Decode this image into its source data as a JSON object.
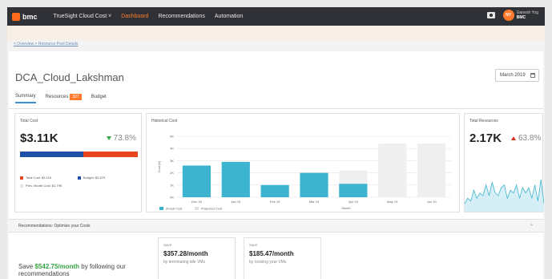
{
  "topbar": {
    "logo": "bmc",
    "product": "TrueSight Cloud Cost",
    "nav": [
      "Dashboard",
      "Recommendations",
      "Automation"
    ],
    "active_nav": "Dashboard",
    "avatar_initials": "NY",
    "user_name": "Ganesh Yog",
    "user_tenant": "BMC"
  },
  "breadcrumb": "< Overview > Resource Pool Details",
  "page": {
    "title": "DCA_Cloud_Lakshman",
    "date": "March 2019"
  },
  "tabs": {
    "summary": "Summary",
    "resources": "Resources",
    "resources_count": "327",
    "budget": "Budget"
  },
  "total_cost": {
    "title": "Total Cost",
    "value": "$3.11K",
    "delta": "73.8%",
    "budget_fraction": 0.54,
    "legend_total": "Total Cost: $3.11K",
    "legend_budget": "Budget: $3.67K",
    "legend_prev": "Prev. Month Cost: $1.79K",
    "colors": {
      "budget": "#1f4fa6",
      "cost": "#e8451f"
    }
  },
  "historical": {
    "title": "Historical Cost"
  },
  "chart_data": {
    "type": "bar",
    "categories": [
      "Dec 18",
      "Jan 19",
      "Feb 19",
      "Mar 19",
      "Apr 19",
      "May 19",
      "Jun 19"
    ],
    "series": [
      {
        "name": "Actual Cost",
        "values": [
          2.6,
          2.9,
          1.0,
          2.0,
          1.1,
          null,
          null
        ]
      },
      {
        "name": "Projected Cost",
        "values": [
          null,
          null,
          null,
          null,
          2.2,
          4.4,
          4.4
        ]
      }
    ],
    "ylabel": "Cost (K)",
    "xlabel": "Month",
    "yticks": [
      "0K",
      "1K",
      "2K",
      "3K",
      "4K",
      "5K"
    ],
    "ylim": [
      0,
      5
    ],
    "colors": {
      "actual": "#3cb4cf",
      "projected": "#efefef"
    },
    "legend_placement": "bottom-left"
  },
  "resources": {
    "title": "Total Resources",
    "value": "2.17K",
    "delta": "63.8%",
    "sparkline": [
      3,
      5,
      4,
      8,
      5,
      7,
      6,
      10,
      6,
      11,
      7,
      6,
      9,
      10,
      5,
      8,
      7,
      10,
      5,
      9,
      7,
      9,
      5,
      10,
      4,
      12,
      3
    ],
    "color": "#3cb4cf"
  },
  "recommendations": {
    "title": "Recommendations: Optimize your Costs",
    "save_prefix": "Save",
    "save_amount": "$542.75/month",
    "save_suffix": "by following our recommendations",
    "cards": [
      {
        "label": "SAVE",
        "value": "$357.28/month",
        "desc": "by terminating idle VMs"
      },
      {
        "label": "SAVE",
        "value": "$185.47/month",
        "desc": "by resizing your VMs"
      }
    ]
  }
}
